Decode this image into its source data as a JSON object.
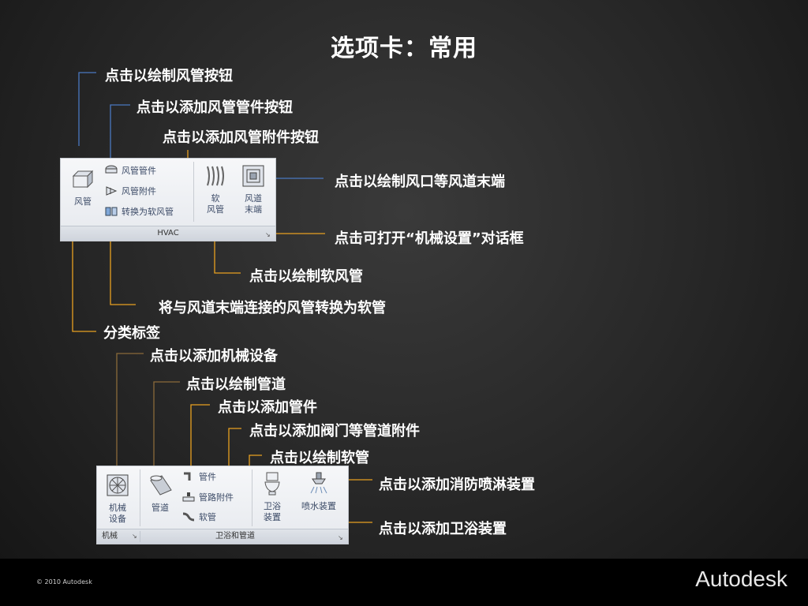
{
  "title": "选项卡：常用",
  "callouts": {
    "draw_duct": "点击以绘制风管按钮",
    "add_duct_fitting": "点击以添加风管管件按钮",
    "add_duct_accessory": "点击以添加风管附件按钮",
    "draw_air_terminal": "点击以绘制风口等风道末端",
    "open_mech_settings": "点击可打开“机械设置”对话框",
    "draw_flex_duct": "点击以绘制软风管",
    "convert_to_flex": "将与风道末端连接的风管转换为软管",
    "category_label": "分类标签",
    "add_mech_equipment": "点击以添加机械设备",
    "draw_pipe": "点击以绘制管道",
    "add_pipe_fitting": "点击以添加管件",
    "add_pipe_accessory": "点击以添加阀门等管道附件",
    "draw_flex_pipe": "点击以绘制软管",
    "add_sprinkler": "点击以添加消防喷淋装置",
    "add_plumbing_fixture": "点击以添加卫浴装置"
  },
  "hvac_panel": {
    "duct_label": "风管",
    "duct_fitting_label": "风管管件",
    "duct_accessory_label": "风管附件",
    "convert_flex_label": "转换为软风管",
    "flex_duct_label_1": "软",
    "flex_duct_label_2": "风管",
    "air_terminal_label_1": "风道",
    "air_terminal_label_2": "末端",
    "footer": "HVAC",
    "launcher": "↘"
  },
  "plumbing_panel": {
    "mech_equipment_label_1": "机械",
    "mech_equipment_label_2": "设备",
    "pipe_label": "管道",
    "pipe_fitting_label": "管件",
    "pipe_accessory_label": "管路附件",
    "flex_pipe_label": "软管",
    "plumbing_fixture_label_1": "卫浴",
    "plumbing_fixture_label_2": "装置",
    "sprinkler_label": "喷水装置",
    "footer_mech": "机械",
    "footer_plumbing": "卫浴和管道",
    "launcher": "↘"
  },
  "footer": {
    "copyright": "© 2010 Autodesk",
    "brand": "Autodesk"
  },
  "colors": {
    "line_blue": "#4a78c0",
    "line_orange": "#e8a020",
    "line_brown": "#8a6a3a",
    "background": "#262626"
  }
}
